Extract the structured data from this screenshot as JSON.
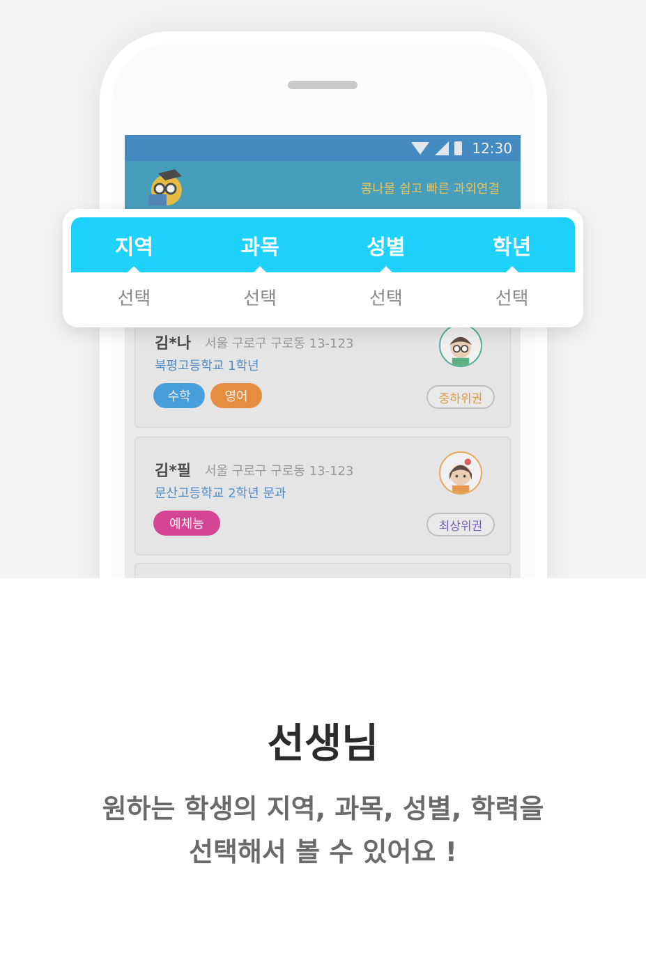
{
  "statusbar": {
    "time": "12:30"
  },
  "app": {
    "tagline": "콩나물 쉽고 빠른 과외연결"
  },
  "filters": [
    {
      "label": "지역",
      "value": "선택"
    },
    {
      "label": "과목",
      "value": "선택"
    },
    {
      "label": "성별",
      "value": "선택"
    },
    {
      "label": "학년",
      "value": "선택"
    }
  ],
  "cards": [
    {
      "name": "김*나",
      "address": "서울 구로구 구로동 13-123",
      "school": "북평고등학교 1학년",
      "subjects": [
        "수학",
        "영어"
      ],
      "grade": "중하위권"
    },
    {
      "name": "김*필",
      "address": "서울 구로구 구로동 13-123",
      "school": "문산고등학교 2학년 문과",
      "subjects": [
        "예체능"
      ],
      "grade": "최상위권"
    }
  ],
  "colors": {
    "header": "#1c8fb8",
    "statusbar": "#1877c1",
    "filter_accent": "#1ed2fd",
    "pill_math": "#1e90e0",
    "pill_english": "#f07a12",
    "pill_arts": "#d81b82",
    "grade_mid_low": "#e08a1a",
    "grade_top": "#5a3fc0"
  },
  "footer": {
    "title": "선생님",
    "line1": "원하는 학생의 지역, 과목, 성별, 학력을",
    "line2": "선택해서 볼 수 있어요 !"
  }
}
